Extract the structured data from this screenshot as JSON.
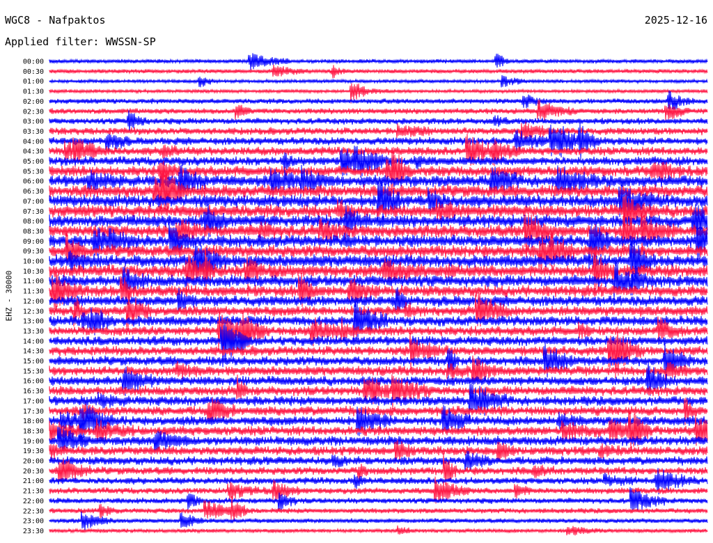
{
  "header": {
    "station": "WGC8 - Nafpaktos",
    "filter": "Applied filter: WWSSN-SP",
    "date": "2025-12-16"
  },
  "chart_data": {
    "type": "line",
    "title": "WGC8 - Nafpaktos",
    "subtitle": "Applied filter: WWSSN-SP",
    "ylabel": "EHZ - 30000",
    "date": "2025-12-16",
    "trace_labels": [
      "00:00",
      "00:30",
      "01:00",
      "01:30",
      "02:00",
      "02:30",
      "03:00",
      "03:30",
      "04:00",
      "04:30",
      "05:00",
      "05:30",
      "06:00",
      "06:30",
      "07:00",
      "07:30",
      "08:00",
      "08:30",
      "09:00",
      "09:30",
      "10:00",
      "10:30",
      "11:00",
      "11:30",
      "12:00",
      "12:30",
      "13:00",
      "13:30",
      "14:00",
      "14:30",
      "15:00",
      "15:30",
      "16:00",
      "16:30",
      "17:00",
      "17:30",
      "18:00",
      "18:30",
      "19:00",
      "19:30",
      "20:00",
      "20:30",
      "21:00",
      "21:30",
      "22:00",
      "22:30",
      "23:00",
      "23:30"
    ],
    "trace_colors": [
      "#0000ff",
      "#ff1744"
    ],
    "relative_activity": [
      0.25,
      0.25,
      0.2,
      0.2,
      0.35,
      0.4,
      0.45,
      0.55,
      0.6,
      0.65,
      0.7,
      0.85,
      0.95,
      1.0,
      1.0,
      1.0,
      1.0,
      1.0,
      1.0,
      1.0,
      1.0,
      1.0,
      0.95,
      0.9,
      0.85,
      0.8,
      0.8,
      0.75,
      0.75,
      0.75,
      0.75,
      0.75,
      0.75,
      0.75,
      0.75,
      0.75,
      0.75,
      0.75,
      0.75,
      0.7,
      0.65,
      0.6,
      0.5,
      0.45,
      0.4,
      0.35,
      0.3,
      0.25
    ]
  }
}
